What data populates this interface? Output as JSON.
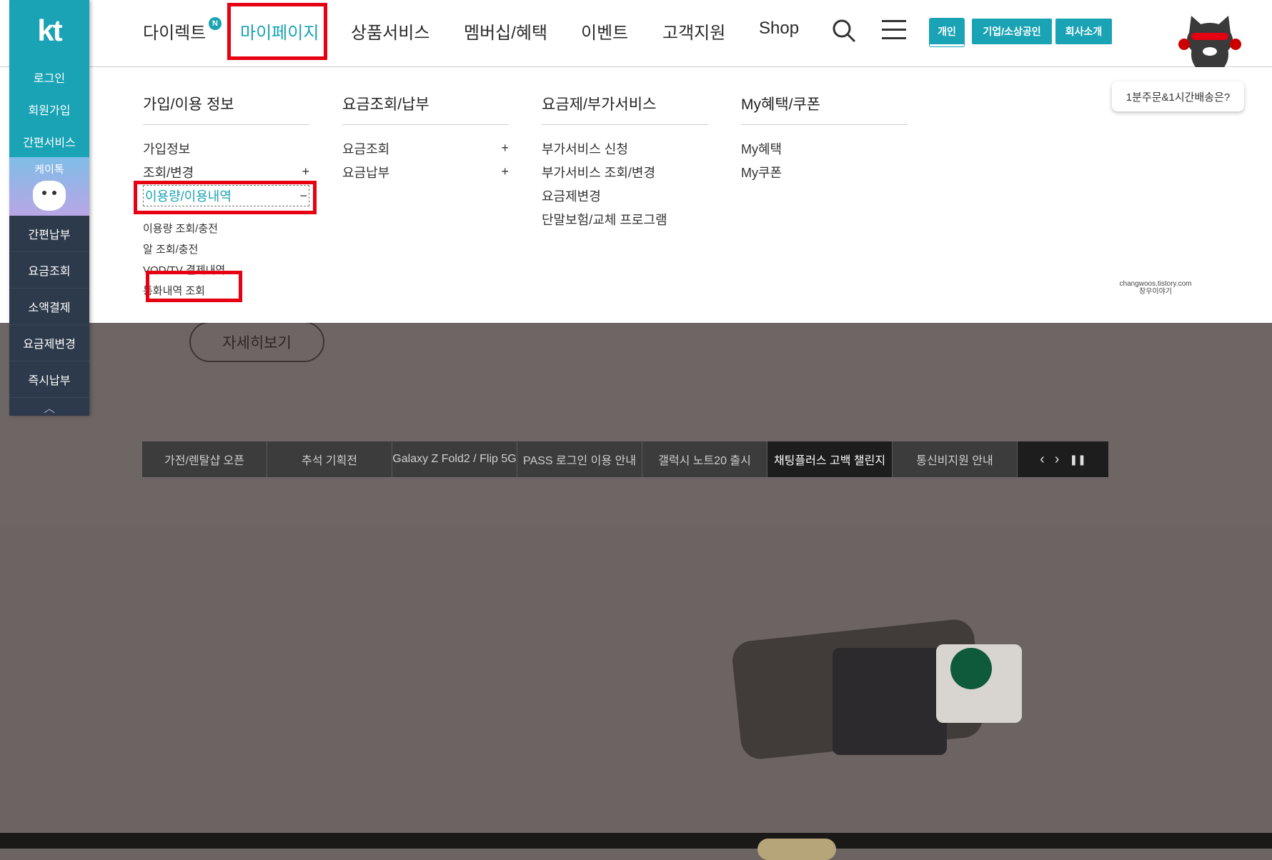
{
  "sidebar": {
    "logo": "kt",
    "teal_items": [
      "로그인",
      "회원가입",
      "간편서비스"
    ],
    "ktalk": "케이톡",
    "dark_items": [
      "간편납부",
      "요금조회",
      "소액결제",
      "요금제변경",
      "즉시납부"
    ],
    "up_icon": "chevron-up-icon"
  },
  "gnb": {
    "items": [
      "다이렉트",
      "마이페이지",
      "상품서비스",
      "멤버십/혜택",
      "이벤트",
      "고객지원",
      "Shop"
    ],
    "new_badge": "N",
    "active": "마이페이지"
  },
  "segments": [
    "개인",
    "기업/소상공인",
    "회사소개"
  ],
  "mascot": {
    "bubble": "1분주문&1시간배송은?"
  },
  "watermark": {
    "line1": "changwoos.tistory.com",
    "line2": "창우이야기"
  },
  "mega": {
    "col1": {
      "title": "가입/이용 정보",
      "items": [
        {
          "label": "가입정보",
          "sign": ""
        },
        {
          "label": "조회/변경",
          "sign": "+"
        },
        {
          "label": "이용량/이용내역",
          "sign": "−"
        }
      ],
      "sub": [
        "이용량 조회/충전",
        "알 조회/충전",
        "VOD/TV 결제내역",
        "통화내역 조회"
      ]
    },
    "col2": {
      "title": "요금조회/납부",
      "items": [
        {
          "label": "요금조회",
          "sign": "+"
        },
        {
          "label": "요금납부",
          "sign": "+"
        }
      ]
    },
    "col3": {
      "title": "요금제/부가서비스",
      "items": [
        "부가서비스 신청",
        "부가서비스 조회/변경",
        "요금제변경",
        "단말보험/교체 프로그램"
      ]
    },
    "col4": {
      "title": "My혜택/쿠폰",
      "items": [
        "My혜택",
        "My쿠폰"
      ]
    }
  },
  "hero": {
    "more_button": "자세히보기"
  },
  "carousel": {
    "items": [
      "가전/렌탈샵 오픈",
      "추석 기획전",
      "Galaxy Z Fold2 / Flip 5G",
      "PASS 로그인 이용 안내",
      "갤럭시 노트20 출시",
      "채팅플러스 고백 챌린지",
      "통신비지원 안내"
    ],
    "active_index": 5,
    "prev": "‹",
    "next": "›",
    "pause": "❚❚"
  },
  "colors": {
    "accent": "#1aa3b4",
    "highlight": "#e60012",
    "sidebar": "#2d3a4b"
  }
}
